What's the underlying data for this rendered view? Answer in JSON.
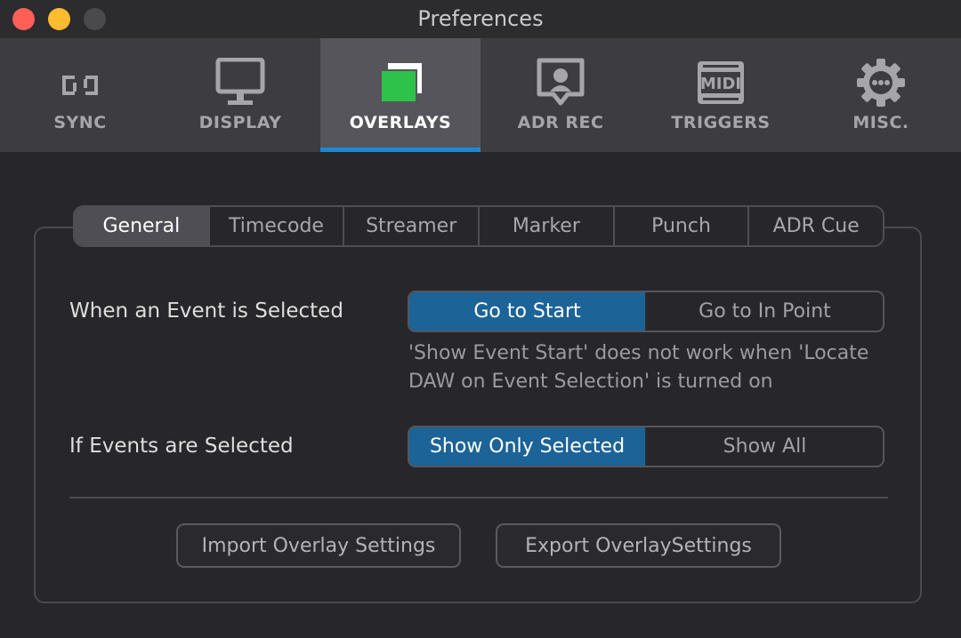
{
  "window": {
    "title": "Preferences"
  },
  "toolbar": {
    "items": [
      {
        "label": "SYNC",
        "icon": "sync-icon"
      },
      {
        "label": "DISPLAY",
        "icon": "monitor-icon"
      },
      {
        "label": "OVERLAYS",
        "icon": "overlays-icon",
        "active": true
      },
      {
        "label": "ADR REC",
        "icon": "speech-bubble-icon"
      },
      {
        "label": "TRIGGERS",
        "icon": "midi-icon"
      },
      {
        "label": "MISC.",
        "icon": "gear-icon"
      }
    ],
    "accent_color": "#1f88d2"
  },
  "subtabs": {
    "items": [
      "General",
      "Timecode",
      "Streamer",
      "Marker",
      "Punch",
      "ADR Cue"
    ],
    "active": "General"
  },
  "settings": {
    "event_selected": {
      "label": "When an Event is Selected",
      "options": [
        "Go to Start",
        "Go to In Point"
      ],
      "selected": "Go to Start",
      "hint": "'Show Event Start' does not work when 'Locate DAW on Event Selection' is turned on"
    },
    "events_selected": {
      "label": "If Events are Selected",
      "options": [
        "Show Only Selected",
        "Show All"
      ],
      "selected": "Show Only Selected"
    }
  },
  "buttons": {
    "import": "Import Overlay Settings",
    "export": "Export OverlaySettings"
  },
  "colors": {
    "selected_segment": "#1c6398",
    "overlay_icon_green": "#2fc24a"
  }
}
